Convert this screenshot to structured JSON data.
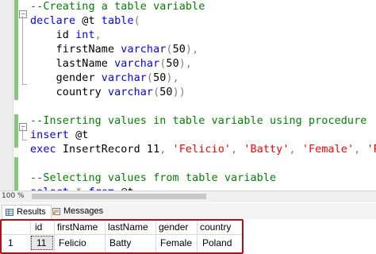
{
  "editor": {
    "lines": [
      {
        "segments": [
          {
            "t": "--Creating a table variable",
            "c": "cm"
          }
        ]
      },
      {
        "segments": [
          {
            "t": "declare",
            "c": "kw"
          },
          {
            "t": " @t ",
            "c": ""
          },
          {
            "t": "table",
            "c": "kw"
          },
          {
            "t": "(",
            "c": "op"
          }
        ]
      },
      {
        "segments": [
          {
            "t": "    id ",
            "c": ""
          },
          {
            "t": "int",
            "c": "kw"
          },
          {
            "t": ",",
            "c": "op"
          }
        ]
      },
      {
        "segments": [
          {
            "t": "    firstName ",
            "c": ""
          },
          {
            "t": "varchar",
            "c": "kw"
          },
          {
            "t": "(",
            "c": "op"
          },
          {
            "t": "50",
            "c": ""
          },
          {
            "t": "),",
            "c": "op"
          }
        ]
      },
      {
        "segments": [
          {
            "t": "    lastName ",
            "c": ""
          },
          {
            "t": "varchar",
            "c": "kw"
          },
          {
            "t": "(",
            "c": "op"
          },
          {
            "t": "50",
            "c": ""
          },
          {
            "t": "),",
            "c": "op"
          }
        ]
      },
      {
        "segments": [
          {
            "t": "    gender ",
            "c": ""
          },
          {
            "t": "varchar",
            "c": "kw"
          },
          {
            "t": "(",
            "c": "op"
          },
          {
            "t": "50",
            "c": ""
          },
          {
            "t": "),",
            "c": "op"
          }
        ]
      },
      {
        "segments": [
          {
            "t": "    country ",
            "c": ""
          },
          {
            "t": "varchar",
            "c": "kw"
          },
          {
            "t": "(",
            "c": "op"
          },
          {
            "t": "50",
            "c": ""
          },
          {
            "t": "))",
            "c": "op"
          }
        ]
      },
      {
        "segments": []
      },
      {
        "segments": [
          {
            "t": "--Inserting values in table variable using procedure",
            "c": "cm"
          }
        ]
      },
      {
        "segments": [
          {
            "t": "insert",
            "c": "kw"
          },
          {
            "t": " @t",
            "c": ""
          }
        ]
      },
      {
        "segments": [
          {
            "t": "exec",
            "c": "kw"
          },
          {
            "t": " InsertRecord 11",
            "c": ""
          },
          {
            "t": ", ",
            "c": "op"
          },
          {
            "t": "'Felicio'",
            "c": "st"
          },
          {
            "t": ", ",
            "c": "op"
          },
          {
            "t": "'Batty'",
            "c": "st"
          },
          {
            "t": ", ",
            "c": "op"
          },
          {
            "t": "'Female'",
            "c": "st"
          },
          {
            "t": ", ",
            "c": "op"
          },
          {
            "t": "'Poland'",
            "c": "st"
          }
        ]
      },
      {
        "segments": []
      },
      {
        "segments": [
          {
            "t": "--Selecting values from table variable",
            "c": "cm"
          }
        ]
      },
      {
        "segments": [
          {
            "t": "select",
            "c": "kw"
          },
          {
            "t": " ",
            "c": ""
          },
          {
            "t": "*",
            "c": "op"
          },
          {
            "t": " ",
            "c": ""
          },
          {
            "t": "from",
            "c": "kw"
          },
          {
            "t": " @t",
            "c": ""
          }
        ]
      }
    ]
  },
  "status": {
    "zoom": "100 %"
  },
  "results": {
    "tabs": [
      {
        "label": "Results",
        "icon": "grid-icon"
      },
      {
        "label": "Messages",
        "icon": "messages-icon"
      }
    ],
    "columns": [
      "id",
      "firstName",
      "lastName",
      "gender",
      "country"
    ],
    "rows": [
      {
        "row_num": "1",
        "cells": [
          "11",
          "Felicio",
          "Batty",
          "Female",
          "Poland"
        ]
      }
    ]
  }
}
